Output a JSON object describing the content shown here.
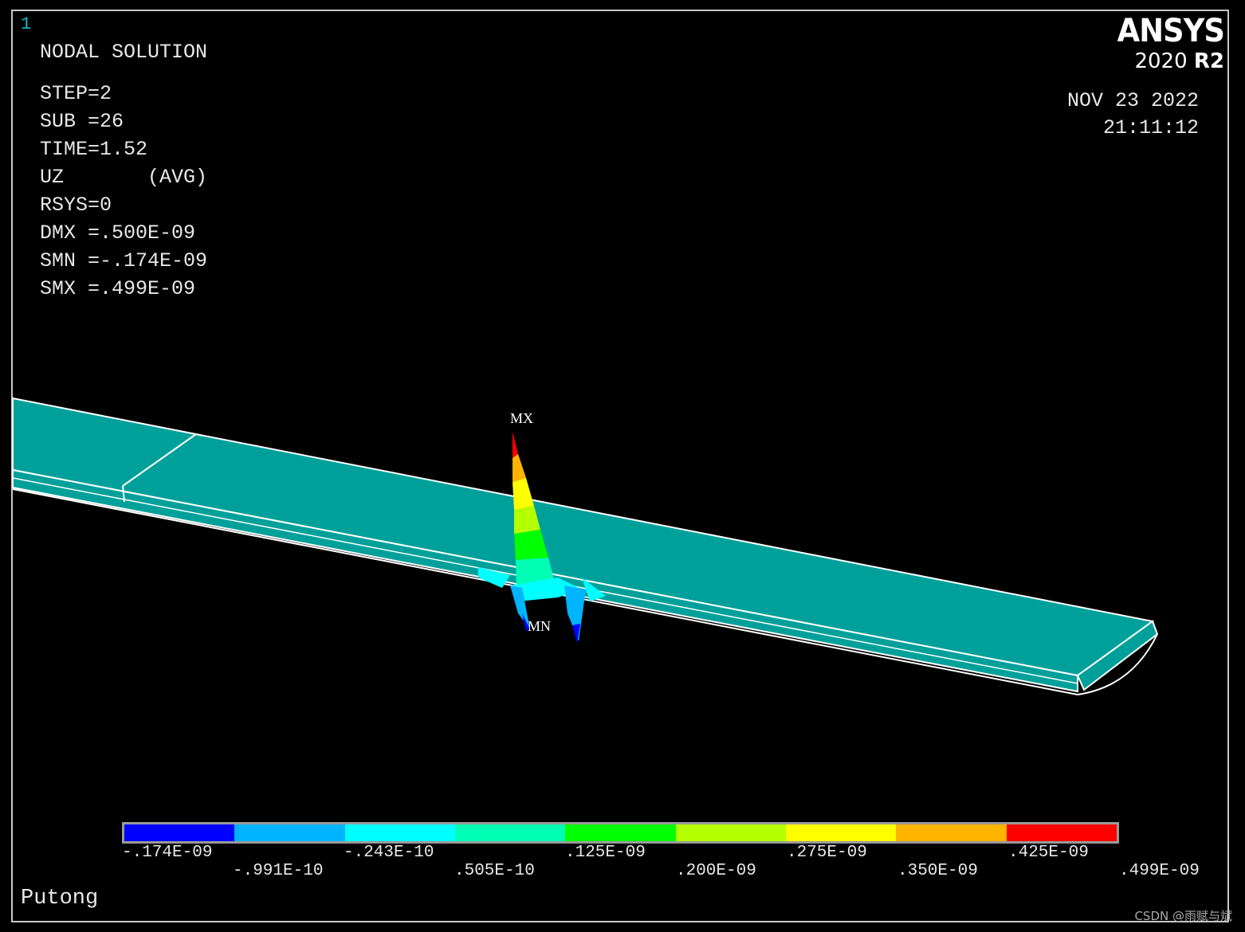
{
  "window": {
    "number": "1"
  },
  "logo": {
    "brand": "ANSYS",
    "version": "2020",
    "release": "R2"
  },
  "header": {
    "title": "NODAL SOLUTION",
    "step": "STEP=2",
    "sub": "SUB =26",
    "time": "TIME=1.52",
    "result": "UZ       (AVG)",
    "rsys": "RSYS=0",
    "dmx": "DMX =.500E-09",
    "smn": "SMN =-.174E-09",
    "smx": "SMX =.499E-09"
  },
  "datetime": {
    "date": "NOV 23 2022",
    "time": "21:11:12"
  },
  "markers": {
    "max": "MX",
    "min": "MN"
  },
  "legend": {
    "colors": [
      "#0000ff",
      "#00b4ff",
      "#00ffff",
      "#00ffb4",
      "#00ff00",
      "#b4ff00",
      "#ffff00",
      "#ffb400",
      "#ff0000"
    ],
    "labels_top": [
      "-.174E-09",
      "-.243E-10",
      ".125E-09",
      ".275E-09",
      ".425E-09"
    ],
    "labels_bottom": [
      "-.991E-10",
      ".505E-10",
      ".200E-09",
      ".350E-09",
      ".499E-09"
    ]
  },
  "footer": {
    "title": "Putong"
  },
  "watermark": "CSDN @雨赋与斌"
}
